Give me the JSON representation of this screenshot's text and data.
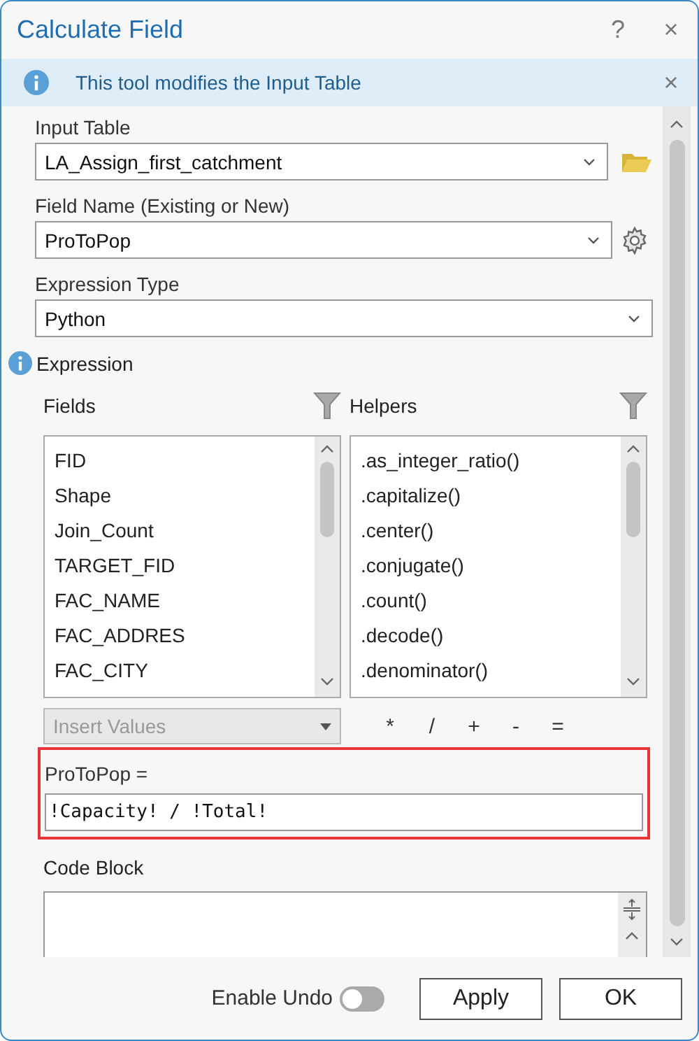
{
  "window": {
    "title": "Calculate Field",
    "help": "?",
    "close": "×"
  },
  "info_bar": {
    "message": "This tool modifies the Input Table",
    "close": "×"
  },
  "input_table": {
    "label": "Input Table",
    "value": "LA_Assign_first_catchment"
  },
  "field_name": {
    "label": "Field Name (Existing or New)",
    "value": "ProToPop"
  },
  "expression_type": {
    "label": "Expression Type",
    "value": "Python"
  },
  "expression": {
    "label": "Expression",
    "fields": {
      "label": "Fields",
      "items": [
        "FID",
        "Shape",
        "Join_Count",
        "TARGET_FID",
        "FAC_NAME",
        "FAC_ADDRES",
        "FAC_CITY"
      ]
    },
    "helpers": {
      "label": "Helpers",
      "items": [
        ".as_integer_ratio()",
        ".capitalize()",
        ".center()",
        ".conjugate()",
        ".count()",
        ".decode()",
        ".denominator()"
      ]
    },
    "insert_values": {
      "label": "Insert Values",
      "disabled": true
    },
    "operators": [
      "*",
      "/",
      "+",
      "-",
      "="
    ],
    "target_label": "ProToPop =",
    "value": "!Capacity! / !Total!",
    "highlighted": true
  },
  "code_block": {
    "label": "Code Block"
  },
  "enable_undo": {
    "label": "Enable Undo",
    "on": false
  },
  "buttons": [
    "Apply",
    "OK"
  ]
}
